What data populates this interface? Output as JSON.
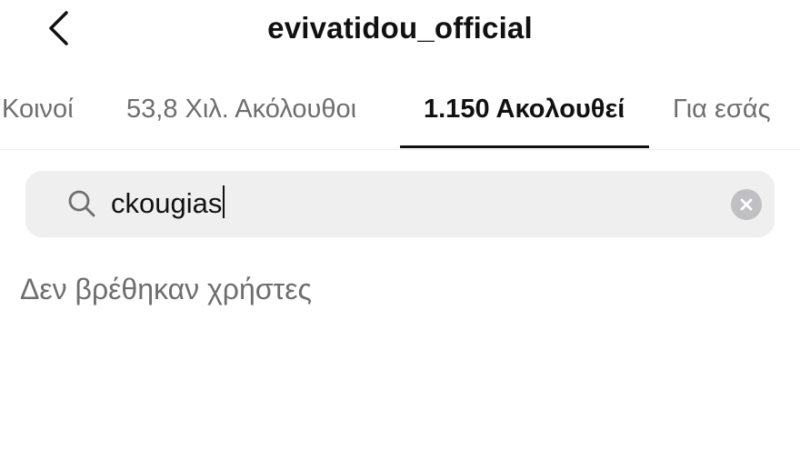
{
  "header": {
    "title": "evivatidou_official",
    "back_icon": "chevron-left-icon"
  },
  "tabs": [
    {
      "label": "Κοινοί",
      "active": false
    },
    {
      "label": "53,8 Χιλ. Ακόλουθοι",
      "active": false
    },
    {
      "label": "1.150 Ακολουθεί",
      "active": true
    },
    {
      "label": "Για εσάς",
      "active": false
    }
  ],
  "search": {
    "value": "ckougias",
    "icon": "search-icon",
    "clear_icon": "clear-icon"
  },
  "results": {
    "empty_message": "Δεν βρέθηκαν χρήστες"
  },
  "colors": {
    "text_primary": "#111111",
    "text_secondary": "#6e6e6e",
    "search_background": "#efeff0",
    "active_indicator": "#111111"
  }
}
